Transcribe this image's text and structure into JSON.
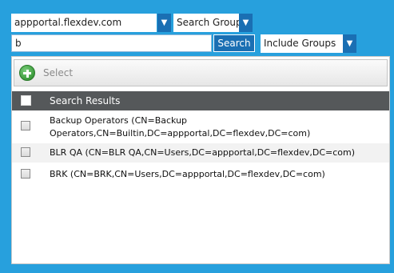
{
  "domain_select": {
    "value": "appportal.flexdev.com"
  },
  "type_select": {
    "value": "Search Group"
  },
  "search": {
    "value": "b",
    "button_label": "Search"
  },
  "scope_select": {
    "value": "Include Groups"
  },
  "toolbar": {
    "select_label": "Select"
  },
  "grid": {
    "header": "Search Results",
    "rows": [
      {
        "line1": "Backup Operators (CN=Backup",
        "line2": "Operators,CN=Builtin,DC=appportal,DC=flexdev,DC=com)"
      },
      {
        "line1": "BLR QA (CN=BLR QA,CN=Users,DC=appportal,DC=flexdev,DC=com)"
      },
      {
        "line1": "BRK (CN=BRK,CN=Users,DC=appportal,DC=flexdev,DC=com)"
      }
    ]
  },
  "icons": {
    "dropdown": "chevron-down-icon",
    "add": "add-circle-icon",
    "checkbox": "checkbox-icon"
  },
  "colors": {
    "background": "#27a0dd",
    "accent": "#1a6fb3",
    "grid_header": "#55585a",
    "add_icon": "#3a9a3a"
  }
}
